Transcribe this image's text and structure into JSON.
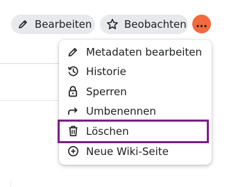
{
  "toolbar": {
    "edit_label": "Bearbeiten",
    "watch_label": "Beobachten",
    "edit_icon": "pencil-icon",
    "watch_icon": "star-icon",
    "more_icon": "ellipsis-icon",
    "more_color": "#f26a3d"
  },
  "menu": {
    "items": [
      {
        "label": "Metadaten bearbeiten",
        "icon": "pencil-icon"
      },
      {
        "label": "Historie",
        "icon": "history-icon"
      },
      {
        "label": "Sperren",
        "icon": "lock-icon"
      },
      {
        "label": "Umbenennen",
        "icon": "rename-arrow-icon"
      },
      {
        "label": "Löschen",
        "icon": "trash-icon",
        "highlighted": true
      },
      {
        "label": "Neue Wiki-Seite",
        "icon": "plus-circle-icon"
      }
    ],
    "highlight_color": "#7b1f88"
  }
}
